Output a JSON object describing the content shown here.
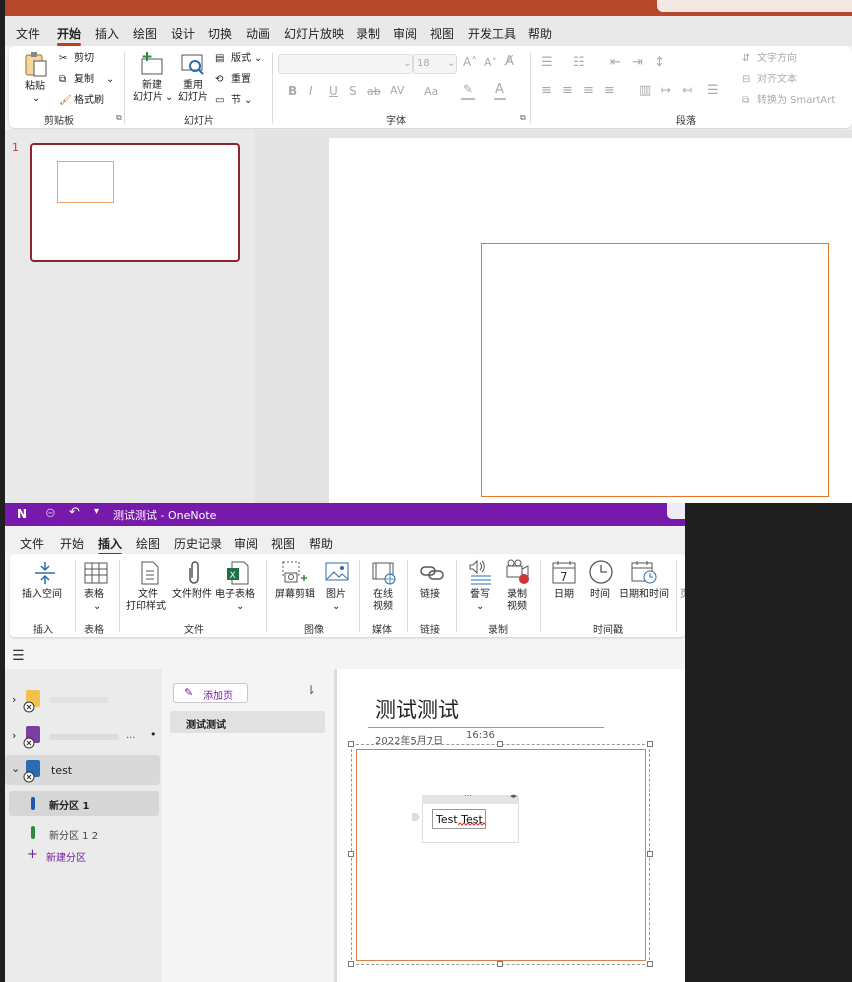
{
  "ppt": {
    "tabs": [
      "文件",
      "开始",
      "插入",
      "绘图",
      "设计",
      "切换",
      "动画",
      "幻灯片放映",
      "录制",
      "审阅",
      "视图",
      "开发工具",
      "帮助"
    ],
    "active_tab": "开始",
    "clipboard": {
      "paste": "粘贴",
      "cut": "剪切",
      "copy": "复制",
      "format_painter": "格式刷",
      "group": "剪贴板"
    },
    "slides": {
      "new_slide_1": "新建",
      "new_slide_2": "幻灯片",
      "reuse_1": "重用",
      "reuse_2": "幻灯片",
      "layout": "版式",
      "reset": "重置",
      "section": "节",
      "group": "幻灯片"
    },
    "font": {
      "size": "18",
      "bold": "B",
      "italic": "I",
      "underline": "U",
      "shadow": "S",
      "strike": "ab",
      "spacing": "AV",
      "case": "Aa",
      "color": "A",
      "group": "字体"
    },
    "paragraph": {
      "text_direction": "文字方向",
      "align_text": "对齐文本",
      "smartart": "转换为 SmartArt",
      "group": "段落"
    },
    "slide_number": "1",
    "accent_color": "#b7472a"
  },
  "onenote": {
    "title": "测试测试  -  OneNote",
    "tabs": [
      "文件",
      "开始",
      "插入",
      "绘图",
      "历史记录",
      "审阅",
      "视图",
      "帮助"
    ],
    "active_tab": "插入",
    "ribbon": {
      "insert_space": "插入空间",
      "table": "表格",
      "file_printout_1": "文件",
      "file_printout_2": "打印样式",
      "file_attachment": "文件附件",
      "spreadsheet": "电子表格",
      "screen_clipping": "屏幕剪辑",
      "pictures": "图片",
      "online_video_1": "在线",
      "online_video_2": "视频",
      "link": "链接",
      "dictate": "誊写",
      "record_video_1": "录制",
      "record_video_2": "视频",
      "date": "日期",
      "time": "时间",
      "date_time": "日期和时间",
      "groups": {
        "insert": "插入",
        "tables": "表格",
        "files": "文件",
        "images": "图像",
        "media": "媒体",
        "links": "链接",
        "recording": "录制",
        "timestamp": "时间戳"
      }
    },
    "notebooks": [
      {
        "name": ""
      },
      {
        "name": "...",
        "trailing": "•"
      },
      {
        "name": "test"
      }
    ],
    "sections": [
      "新分区 1",
      "新分区 1 2"
    ],
    "new_section": "新建分区",
    "add_page": "添加页",
    "pages": [
      "测试测试"
    ],
    "page": {
      "title": "测试测试",
      "date": "2022年5月7日",
      "time": "16:36",
      "note_text": "Test Test"
    },
    "accent_color": "#7719aa"
  }
}
